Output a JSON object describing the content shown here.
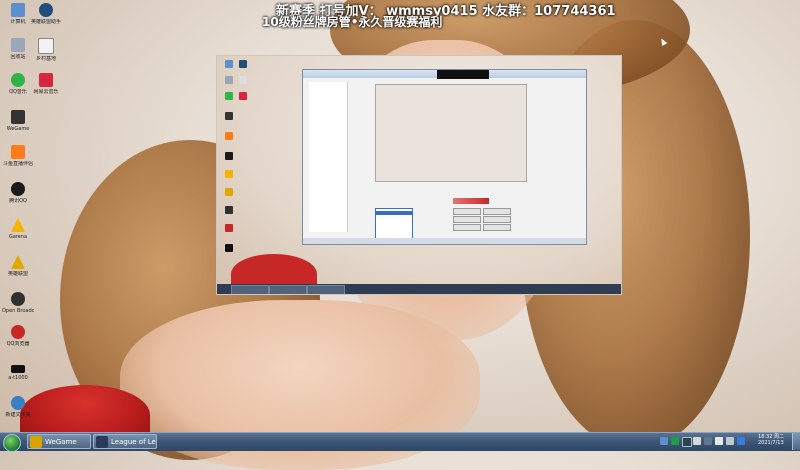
{
  "overlay": {
    "line1": "新赛季 打号加V： wmmsy0415    水友群：107744361",
    "line2": "10级粉丝牌房管•永久晋级赛福利"
  },
  "desktop_icons": [
    {
      "label": "计算机",
      "icon": "computer-icon",
      "color": "#5b8fd0"
    },
    {
      "label": "英雄联盟助手",
      "icon": "lol-helper-icon",
      "color": "#1f4f7a"
    },
    {
      "label": "回收站",
      "icon": "recycle-bin-icon",
      "color": "#9aa7b8"
    },
    {
      "label": "乡村基地",
      "icon": "document-icon",
      "color": "#f2f2f2"
    },
    {
      "label": "QQ音乐",
      "icon": "qq-music-icon",
      "color": "#32b34a"
    },
    {
      "label": "网易云音乐",
      "icon": "netease-music-icon",
      "color": "#d7263d"
    },
    {
      "label": "WeGame",
      "icon": "wegame-icon",
      "color": "#333333"
    },
    {
      "label": "斗鱼直播伴侣",
      "icon": "douyu-icon",
      "color": "#ff7a1a"
    },
    {
      "label": "腾讯QQ",
      "icon": "qq-icon",
      "color": "#1b1b1b"
    },
    {
      "label": "Garena",
      "icon": "garena-icon",
      "color": "#f4b400"
    },
    {
      "label": "英雄联盟",
      "icon": "lol-icon",
      "color": "#e0a800"
    },
    {
      "label": "Open Broadcaster",
      "icon": "obs-icon",
      "color": "#303030"
    },
    {
      "label": "QQ浏览器",
      "icon": "browser-icon",
      "color": "#c62828"
    },
    {
      "label": "a-t1000",
      "icon": "monitor-icon",
      "color": "#111111"
    },
    {
      "label": "新建文件夹",
      "icon": "folder-icon",
      "color": "#3b7ec4"
    }
  ],
  "taskbar": {
    "items": [
      {
        "label": "WeGame",
        "icon": "wegame-icon",
        "color": "#d9a400"
      },
      {
        "label": "League of Lege...",
        "icon": "lol-icon",
        "color": "#2b3a5a"
      }
    ],
    "clock_time": "18:32 周二",
    "clock_date": "2021/7/13"
  }
}
